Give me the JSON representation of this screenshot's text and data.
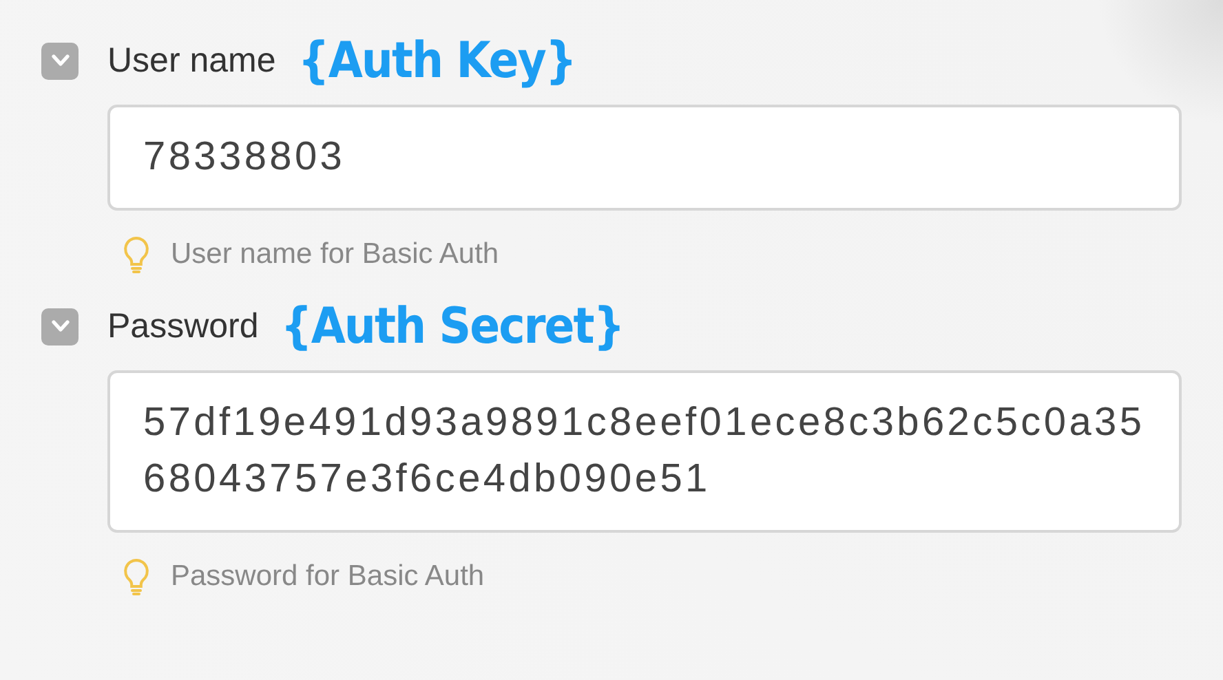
{
  "fields": [
    {
      "label": "User name",
      "annotation": "{Auth Key}",
      "expanded": true,
      "value": "78338803",
      "hint": "User name for Basic Auth"
    },
    {
      "label": "Password",
      "annotation": "{Auth Secret}",
      "expanded": true,
      "value": "57df19e491d93a9891c8eef01ece8c3b62c5c0a3568043757e3f6ce4db090e51",
      "hint": "Password for Basic Auth"
    }
  ]
}
